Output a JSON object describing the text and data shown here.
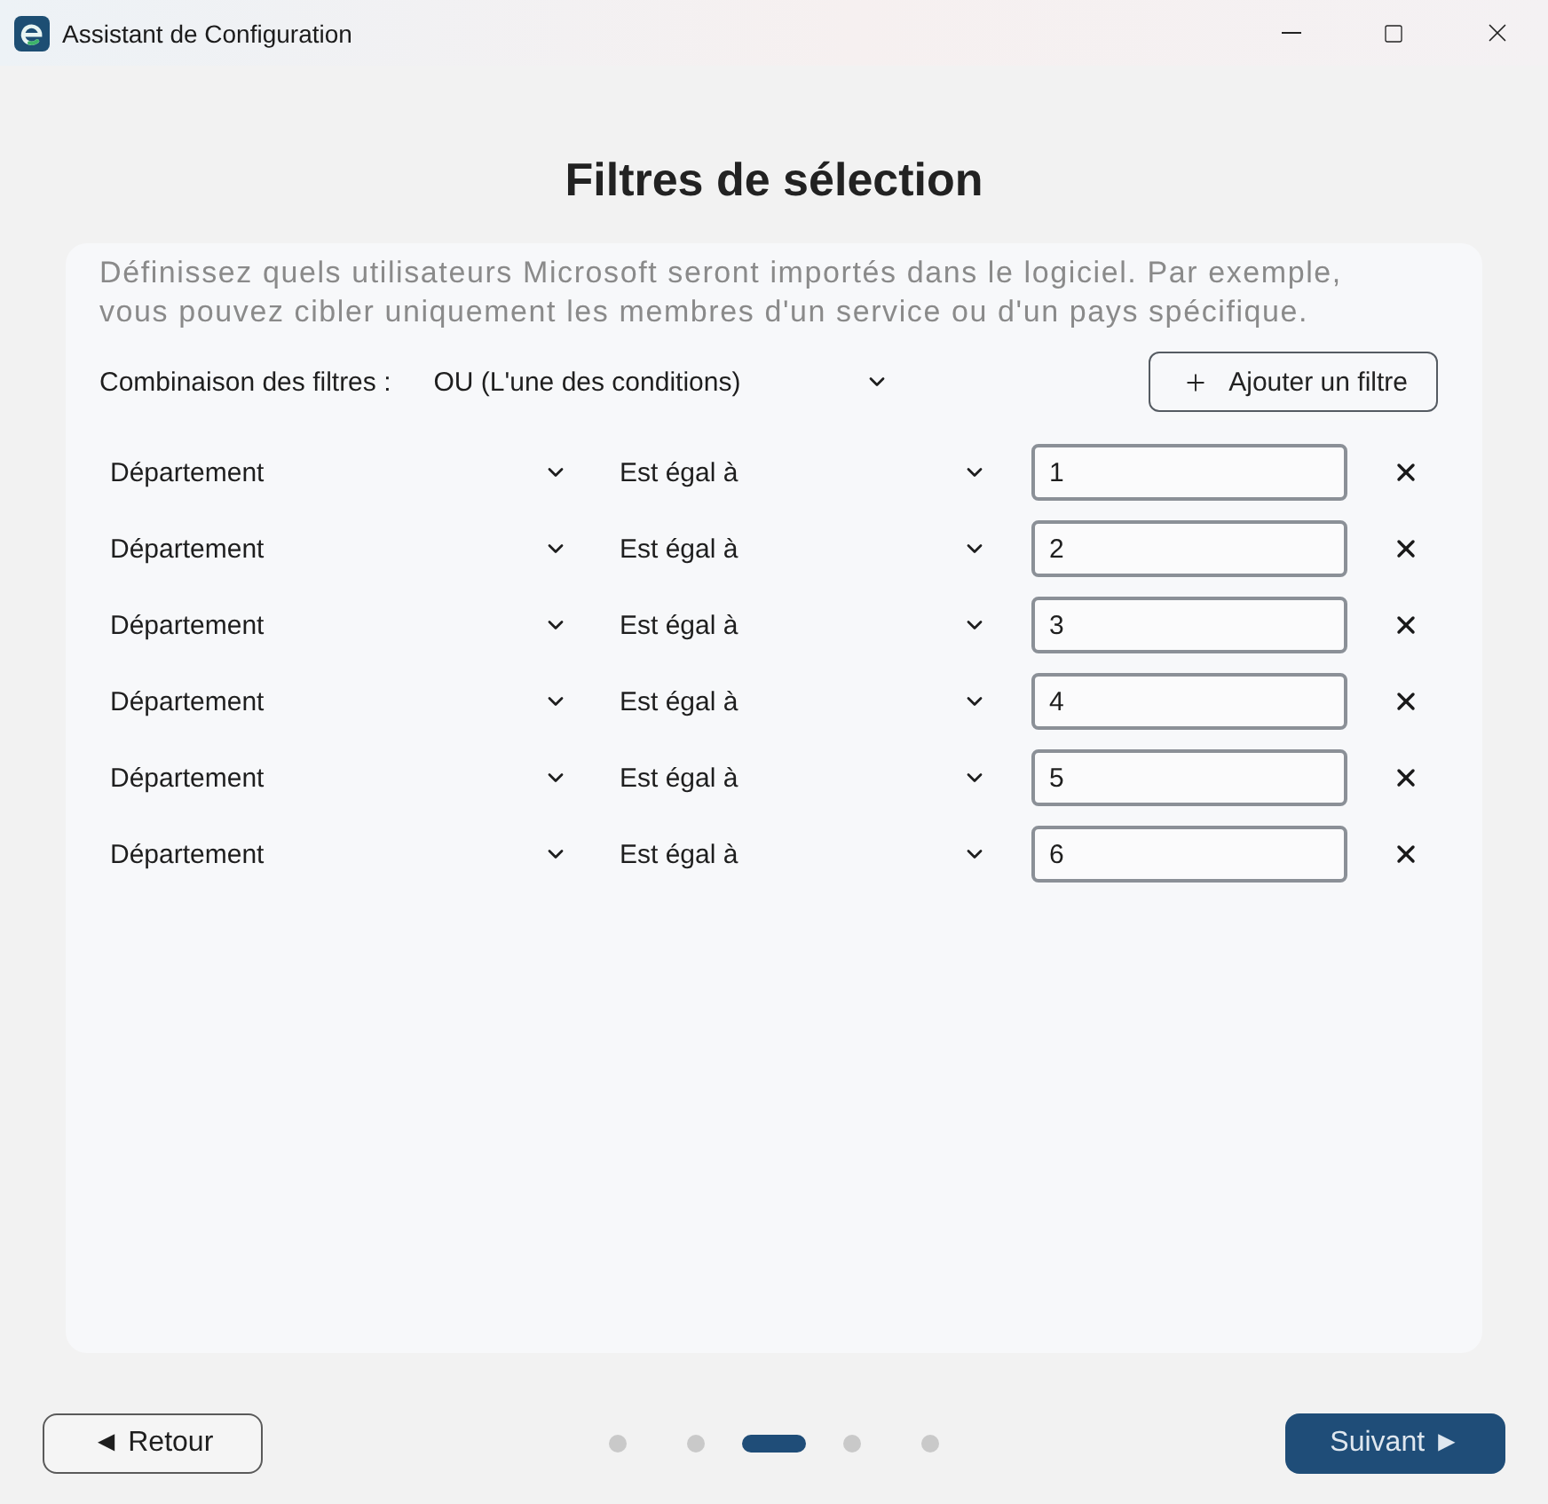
{
  "window": {
    "title": "Assistant de Configuration"
  },
  "page": {
    "title": "Filtres de sélection",
    "description": "Définissez quels utilisateurs Microsoft seront importés dans le logiciel. Par exemple, vous pouvez cibler uniquement les membres d'un service ou d'un pays spécifique."
  },
  "combination": {
    "label": "Combinaison des filtres :",
    "value": "OU (L'une des conditions)"
  },
  "add_button": {
    "label": "Ajouter un filtre"
  },
  "filters": [
    {
      "field": "Département",
      "operator": "Est égal à",
      "value": "1"
    },
    {
      "field": "Département",
      "operator": "Est égal à",
      "value": "2"
    },
    {
      "field": "Département",
      "operator": "Est égal à",
      "value": "3"
    },
    {
      "field": "Département",
      "operator": "Est égal à",
      "value": "4"
    },
    {
      "field": "Département",
      "operator": "Est égal à",
      "value": "5"
    },
    {
      "field": "Département",
      "operator": "Est égal à",
      "value": "6"
    }
  ],
  "pager": {
    "steps": [
      {
        "selected": false
      },
      {
        "selected": false
      },
      {
        "selected": true
      },
      {
        "selected": false
      },
      {
        "selected": false
      }
    ]
  },
  "buttons": {
    "back": "◄ Retour",
    "next": "Suivant ►"
  }
}
